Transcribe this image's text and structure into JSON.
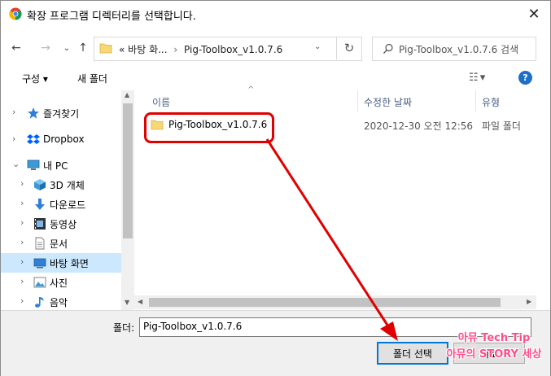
{
  "window": {
    "title": "확장 프로그램 디렉터리를 선택합니다.",
    "close_glyph": "✕"
  },
  "address": {
    "overflow": "«",
    "crumb1": "바탕 화...",
    "crumb2": "Pig-Toolbox_v1.0.7.6",
    "search_placeholder": "Pig-Toolbox_v1.0.7.6 검색"
  },
  "toolbar": {
    "organize_label": "구성 ▾",
    "new_folder_label": "새 폴더",
    "help_glyph": "?"
  },
  "sidebar": {
    "items": [
      {
        "label": "즐겨찾기",
        "icon": "star-icon"
      },
      {
        "label": "Dropbox",
        "icon": "dropbox-icon"
      },
      {
        "label": "내 PC",
        "icon": "pc-icon"
      },
      {
        "label": "3D 개체",
        "icon": "cube-icon"
      },
      {
        "label": "다운로드",
        "icon": "download-icon"
      },
      {
        "label": "동영상",
        "icon": "video-icon"
      },
      {
        "label": "문서",
        "icon": "document-icon"
      },
      {
        "label": "바탕 화면",
        "icon": "desktop-icon"
      },
      {
        "label": "사진",
        "icon": "picture-icon"
      },
      {
        "label": "음악",
        "icon": "music-icon"
      }
    ]
  },
  "columns": {
    "name": "이름",
    "modified": "수정한 날짜",
    "type": "유형"
  },
  "files": [
    {
      "name": "Pig-Toolbox_v1.0.7.6",
      "modified": "2020-12-30 오전 12:56",
      "type": "파일 폴더"
    }
  ],
  "bottom": {
    "folder_label": "폴더:",
    "folder_value": "Pig-Toolbox_v1.0.7.6",
    "select_button": "폴더 선택",
    "cancel_button": "취소"
  },
  "watermark": {
    "line1": "아뮤 Tech Tip",
    "line2": "아뮤의 STORY 세상"
  },
  "colors": {
    "accent": "#0078d7",
    "highlight": "#e00000",
    "selection": "#cce8ff",
    "folder": "#f8d775"
  }
}
